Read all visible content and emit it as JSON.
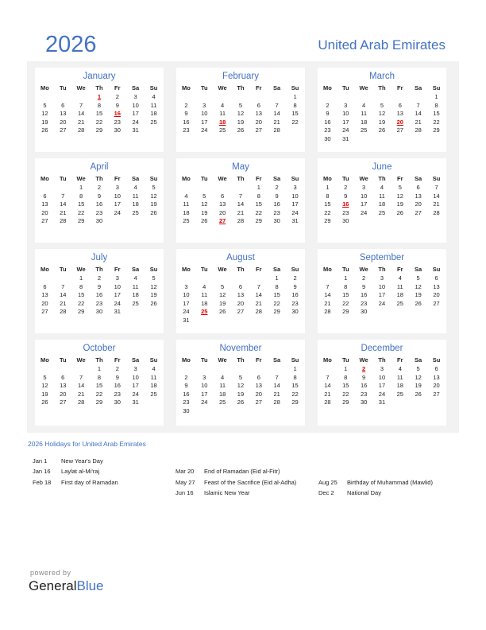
{
  "header": {
    "year": "2026",
    "country": "United Arab Emirates"
  },
  "weekdays": [
    "Mo",
    "Tu",
    "We",
    "Th",
    "Fr",
    "Sa",
    "Su"
  ],
  "months": [
    {
      "name": "January",
      "offset": 3,
      "days": 31,
      "holidays": [
        1,
        16
      ]
    },
    {
      "name": "February",
      "offset": 6,
      "days": 28,
      "holidays": [
        18
      ]
    },
    {
      "name": "March",
      "offset": 6,
      "days": 31,
      "holidays": [
        20
      ]
    },
    {
      "name": "April",
      "offset": 2,
      "days": 30,
      "holidays": []
    },
    {
      "name": "May",
      "offset": 4,
      "days": 31,
      "holidays": [
        27
      ]
    },
    {
      "name": "June",
      "offset": 0,
      "days": 30,
      "holidays": [
        16
      ]
    },
    {
      "name": "July",
      "offset": 2,
      "days": 31,
      "holidays": []
    },
    {
      "name": "August",
      "offset": 5,
      "days": 31,
      "holidays": [
        25
      ]
    },
    {
      "name": "September",
      "offset": 1,
      "days": 30,
      "holidays": []
    },
    {
      "name": "October",
      "offset": 3,
      "days": 31,
      "holidays": []
    },
    {
      "name": "November",
      "offset": 6,
      "days": 30,
      "holidays": []
    },
    {
      "name": "December",
      "offset": 1,
      "days": 31,
      "holidays": [
        2
      ]
    }
  ],
  "holidays_section": {
    "title": "2026 Holidays for United Arab Emirates",
    "columns": [
      [
        {
          "date": "Jan 1",
          "name": "New Year's Day"
        },
        {
          "date": "Jan 16",
          "name": "Laylat al-Mi'raj"
        },
        {
          "date": "Feb 18",
          "name": "First day of Ramadan"
        }
      ],
      [
        {
          "date": "Mar 20",
          "name": "End of Ramadan (Eid al-Fitr)"
        },
        {
          "date": "May 27",
          "name": "Feast of the Sacrifice (Eid al-Adha)"
        },
        {
          "date": "Jun 16",
          "name": "Islamic New Year"
        }
      ],
      [
        {
          "date": "Aug 25",
          "name": "Birthday of Muhammad (Mawlid)"
        },
        {
          "date": "Dec 2",
          "name": "National Day"
        }
      ]
    ]
  },
  "footer": {
    "powered_by": "powered by",
    "brand_part1": "General",
    "brand_part2": "Blue"
  },
  "colors": {
    "accent": "#4472c4",
    "holiday": "#e00000",
    "panel_bg": "#f2f2f2"
  }
}
